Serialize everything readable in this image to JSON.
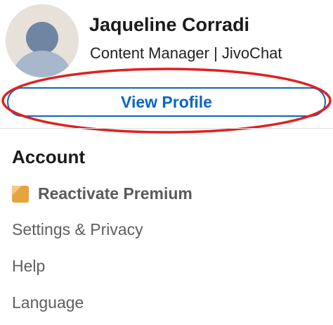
{
  "profile": {
    "name": "Jaqueline Corradi",
    "headline": "Content Manager | JivoChat",
    "view_profile_label": "View Profile"
  },
  "account": {
    "heading": "Account",
    "premium_label": "Reactivate Premium",
    "items": [
      {
        "label": "Settings & Privacy"
      },
      {
        "label": "Help"
      },
      {
        "label": "Language"
      }
    ]
  },
  "colors": {
    "accent": "#0a66c2",
    "highlight_ring": "#e02020",
    "premium_gold": "#e7a33e"
  }
}
